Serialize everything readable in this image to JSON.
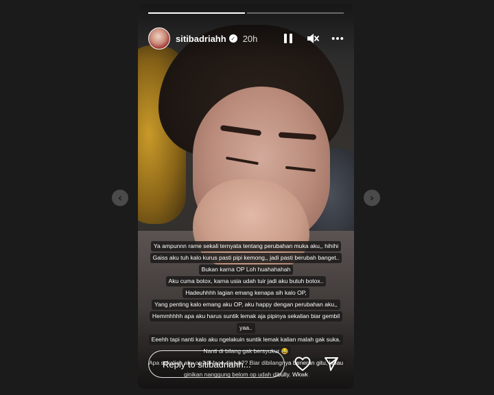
{
  "navigation": {
    "prev_icon": "‹",
    "next_icon": "›"
  },
  "story": {
    "progress": [
      1.0,
      0.0
    ],
    "user": {
      "username": "sitibadriahh",
      "verified_icon": "✓",
      "time": "20h"
    },
    "controls": [
      "pause-icon",
      "muted-speaker-icon",
      "more-options-icon"
    ],
    "caption_lines": [
      "Ya ampunnn rame sekali ternyata tentang perubahan muka aku,, hihihi",
      "Gaiss aku tuh kalo kurus pasti pipi kemong,, jadi pasti berubah banget..",
      "Bukan karna OP Loh huahahahah",
      "Aku cuma botox, karna usia udah tuir jadi aku butuh botox..",
      "Hadeuhhhh lagian emang kenapa sih kalo OP,",
      "Yang penting kalo emang aku OP, aku happy dengan perubahan aku,,",
      "Hemmhhhh apa aku harus suntik lemak aja pipinya sekalian biar gembil",
      "yaa..",
      "Eeehh tapi nanti kalo aku ngelakuin suntik lemak kalian malah gak suka.",
      "Nanti di bilang gak bersyukur 😂",
      "Apa sekalian aku op full face aja ya?? Biar dibilangnya beneran gitu, kalau",
      "ginikan nanggung belom op udah dibully. Wkwk"
    ],
    "reply": {
      "placeholder": "Reply to sitibadriahh..."
    },
    "accent": "#ffffff"
  }
}
